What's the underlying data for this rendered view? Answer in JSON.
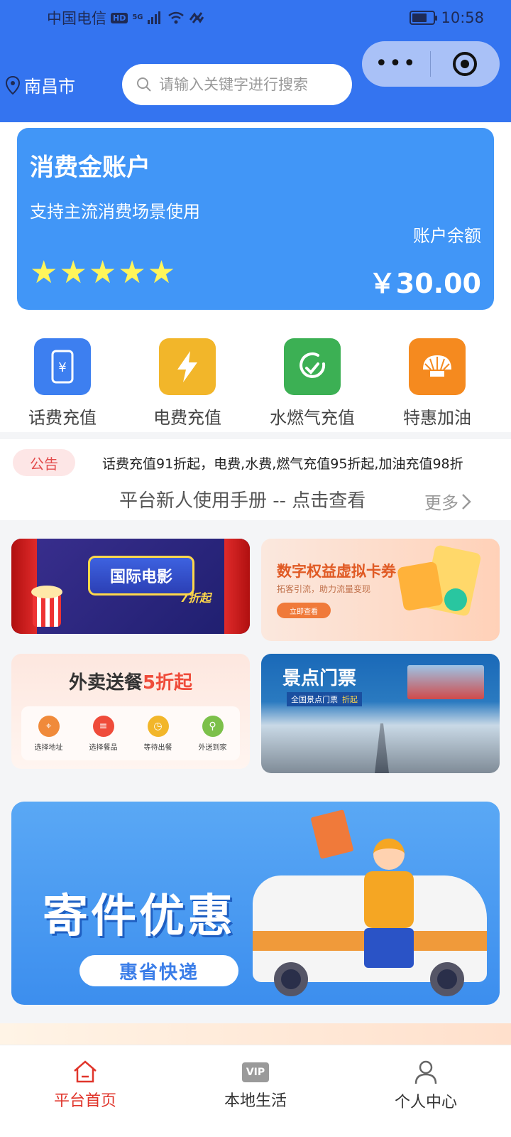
{
  "status_bar": {
    "carrier": "中国电信",
    "hd": "HD",
    "network": "5G",
    "time": "10:58",
    "battery_level": 0.7
  },
  "header": {
    "city": "南昌市",
    "search_placeholder": "请输入关键字进行搜索",
    "menu_glyph": "•••"
  },
  "account": {
    "title": "消费金账户",
    "subtitle": "支持主流消费场景使用",
    "balance_label": "账户余额",
    "stars": "★★★★★",
    "balance": "￥30.00"
  },
  "services": [
    {
      "label": "话费充值",
      "icon": "phone-recharge-icon",
      "color": "#3d7ff0"
    },
    {
      "label": "电费充值",
      "icon": "lightning-icon",
      "color": "#f2b62a"
    },
    {
      "label": "水燃气充值",
      "icon": "water-gas-icon",
      "color": "#3cb054"
    },
    {
      "label": "特惠加油",
      "icon": "fuel-icon",
      "color": "#f58a1f"
    }
  ],
  "notice": {
    "tag": "公告",
    "text": "话费充值91折起，电费,水费,燃气充值95折起,加油充值98折",
    "guide": "平台新人使用手册 -- 点击查看",
    "more": "更多"
  },
  "promos": {
    "movie": {
      "title": "国际电影",
      "discount": "7折起"
    },
    "digital": {
      "title": "数字权益虚拟卡券",
      "subtitle": "拓客引流，助力流量变现",
      "button": "立即查看"
    },
    "food": {
      "title_main": "外卖送餐",
      "title_highlight": "5折起",
      "steps": [
        "选择地址",
        "选择餐品",
        "等待出餐",
        "外送到家"
      ]
    },
    "scenic": {
      "title": "景点门票",
      "subtitle": "全国景点门票",
      "discount": "折起"
    }
  },
  "express": {
    "title": "寄件优惠",
    "subtitle": "惠省快递"
  },
  "tabbar": {
    "active_color": "#e0352b",
    "items": [
      {
        "label": "平台首页",
        "icon": "home-icon"
      },
      {
        "label": "本地生活",
        "icon": "vip-icon",
        "badge": "VIP"
      },
      {
        "label": "个人中心",
        "icon": "user-icon"
      }
    ]
  }
}
